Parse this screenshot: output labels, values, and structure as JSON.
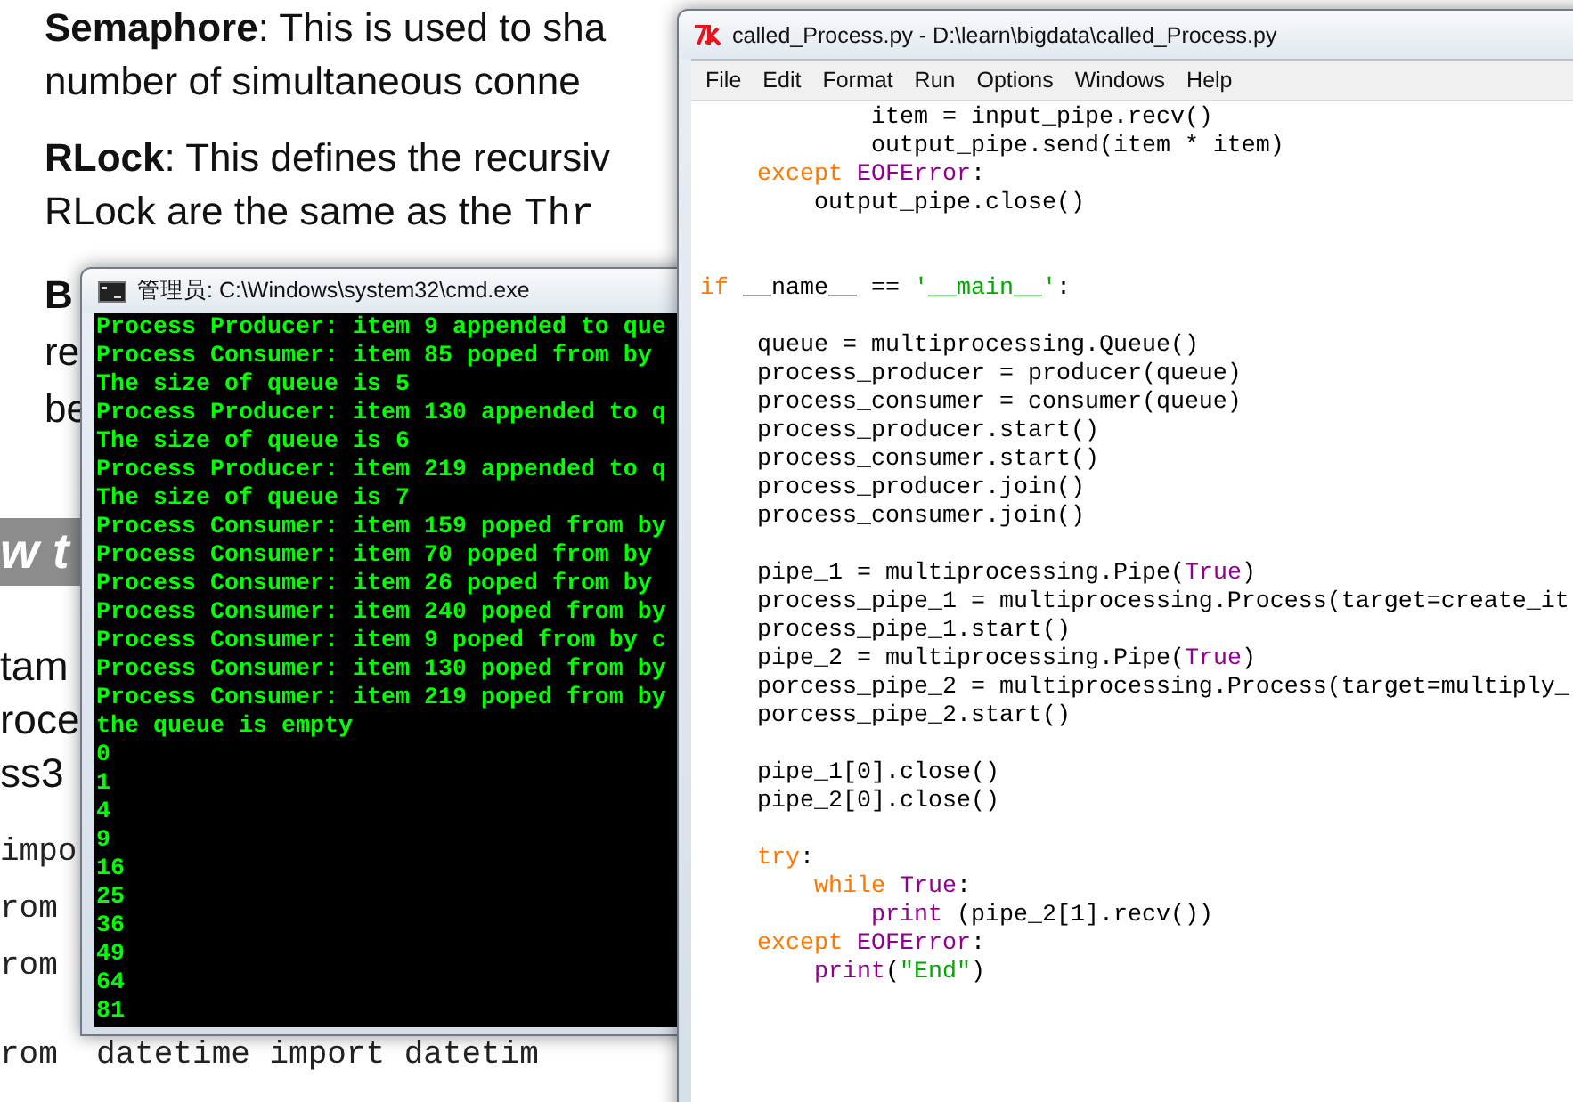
{
  "document": {
    "blocks": [
      {
        "kind": "paragraph",
        "lines": [
          [
            {
              "kind": "bold",
              "text": "Semaphore"
            },
            {
              "kind": "plain",
              "text": ": This is used to sha"
            }
          ],
          [
            {
              "kind": "plain",
              "text": "number of simultaneous conne"
            }
          ]
        ]
      },
      {
        "kind": "paragraph",
        "lines": [
          [
            {
              "kind": "bold",
              "text": "RLock"
            },
            {
              "kind": "plain",
              "text": ": This defines the recursiv"
            }
          ],
          [
            {
              "kind": "plain",
              "text": "RLock are the same as the "
            },
            {
              "kind": "mono",
              "text": "Thr"
            }
          ]
        ]
      },
      {
        "kind": "paragraph",
        "lines": [
          [
            {
              "kind": "bold",
              "text": "B"
            }
          ],
          [
            {
              "kind": "plain",
              "text": "re"
            }
          ],
          [
            {
              "kind": "plain",
              "text": "be"
            }
          ]
        ]
      },
      {
        "kind": "heading",
        "text": "w t"
      },
      {
        "kind": "cut_paragraph",
        "lines": [
          [
            {
              "kind": "plain",
              "text": "tam"
            }
          ],
          [
            {
              "kind": "plain",
              "text": "roce"
            }
          ],
          [
            {
              "kind": "plain",
              "text": "ss3"
            }
          ]
        ]
      },
      {
        "kind": "code",
        "lines": [
          "impo",
          "rom",
          "rom",
          "rom  datetime import datetim"
        ]
      }
    ]
  },
  "console": {
    "title": "管理员: C:\\Windows\\system32\\cmd.exe",
    "lines": [
      "Process Producer: item 9 appended to que",
      "Process Consumer: item 85 poped from by",
      "The size of queue is 5",
      "Process Producer: item 130 appended to q",
      "The size of queue is 6",
      "Process Producer: item 219 appended to q",
      "The size of queue is 7",
      "Process Consumer: item 159 poped from by",
      "Process Consumer: item 70 poped from by",
      "Process Consumer: item 26 poped from by",
      "Process Consumer: item 240 poped from by",
      "Process Consumer: item 9 poped from by c",
      "Process Consumer: item 130 poped from by",
      "Process Consumer: item 219 poped from by",
      "the queue is empty",
      "0",
      "1",
      "4",
      "9",
      "16",
      "25",
      "36",
      "49",
      "64",
      "81"
    ]
  },
  "editor": {
    "title": "called_Process.py - D:\\learn\\bigdata\\called_Process.py",
    "menu": [
      "File",
      "Edit",
      "Format",
      "Run",
      "Options",
      "Windows",
      "Help"
    ],
    "lines": [
      {
        "kind": "code",
        "tokens": [
          {
            "kind": "plain",
            "text": "            item = input_pipe.recv()"
          }
        ]
      },
      {
        "kind": "code",
        "tokens": [
          {
            "kind": "plain",
            "text": "            output_pipe.send(item * item)"
          }
        ]
      },
      {
        "kind": "code",
        "tokens": [
          {
            "kind": "keyword",
            "text": "    except "
          },
          {
            "kind": "builtin",
            "text": "EOFError"
          },
          {
            "kind": "plain",
            "text": ":"
          }
        ]
      },
      {
        "kind": "code",
        "tokens": [
          {
            "kind": "plain",
            "text": "        output_pipe.close()"
          }
        ]
      },
      {
        "kind": "blank"
      },
      {
        "kind": "blank"
      },
      {
        "kind": "code",
        "tokens": [
          {
            "kind": "keyword",
            "text": "if"
          },
          {
            "kind": "plain",
            "text": " __name__ == "
          },
          {
            "kind": "string",
            "text": "'__main__'"
          },
          {
            "kind": "plain",
            "text": ":"
          }
        ]
      },
      {
        "kind": "blank"
      },
      {
        "kind": "code",
        "tokens": [
          {
            "kind": "plain",
            "text": "    queue = multiprocessing.Queue()"
          }
        ]
      },
      {
        "kind": "code",
        "tokens": [
          {
            "kind": "plain",
            "text": "    process_producer = producer(queue)"
          }
        ]
      },
      {
        "kind": "code",
        "tokens": [
          {
            "kind": "plain",
            "text": "    process_consumer = consumer(queue)"
          }
        ]
      },
      {
        "kind": "code",
        "tokens": [
          {
            "kind": "plain",
            "text": "    process_producer.start()"
          }
        ]
      },
      {
        "kind": "code",
        "tokens": [
          {
            "kind": "plain",
            "text": "    process_consumer.start()"
          }
        ]
      },
      {
        "kind": "code",
        "tokens": [
          {
            "kind": "plain",
            "text": "    process_producer.join()"
          }
        ]
      },
      {
        "kind": "code",
        "tokens": [
          {
            "kind": "plain",
            "text": "    process_consumer.join()"
          }
        ]
      },
      {
        "kind": "blank"
      },
      {
        "kind": "code",
        "tokens": [
          {
            "kind": "plain",
            "text": "    pipe_1 = multiprocessing.Pipe("
          },
          {
            "kind": "builtin",
            "text": "True"
          },
          {
            "kind": "plain",
            "text": ")"
          }
        ]
      },
      {
        "kind": "code",
        "tokens": [
          {
            "kind": "plain",
            "text": "    process_pipe_1 = multiprocessing.Process(target=create_it"
          }
        ]
      },
      {
        "kind": "code",
        "tokens": [
          {
            "kind": "plain",
            "text": "    process_pipe_1.start()"
          }
        ]
      },
      {
        "kind": "code",
        "tokens": [
          {
            "kind": "plain",
            "text": "    pipe_2 = multiprocessing.Pipe("
          },
          {
            "kind": "builtin",
            "text": "True"
          },
          {
            "kind": "plain",
            "text": ")"
          }
        ]
      },
      {
        "kind": "code",
        "tokens": [
          {
            "kind": "plain",
            "text": "    porcess_pipe_2 = multiprocessing.Process(target=multiply_"
          }
        ]
      },
      {
        "kind": "code",
        "tokens": [
          {
            "kind": "plain",
            "text": "    porcess_pipe_2.start()"
          }
        ]
      },
      {
        "kind": "blank"
      },
      {
        "kind": "code",
        "tokens": [
          {
            "kind": "plain",
            "text": "    pipe_1[0].close()"
          }
        ]
      },
      {
        "kind": "code",
        "tokens": [
          {
            "kind": "plain",
            "text": "    pipe_2[0].close()"
          }
        ]
      },
      {
        "kind": "blank"
      },
      {
        "kind": "code",
        "tokens": [
          {
            "kind": "keyword",
            "text": "    try"
          },
          {
            "kind": "plain",
            "text": ":"
          }
        ]
      },
      {
        "kind": "code",
        "tokens": [
          {
            "kind": "keyword",
            "text": "        while "
          },
          {
            "kind": "builtin",
            "text": "True"
          },
          {
            "kind": "plain",
            "text": ":"
          }
        ]
      },
      {
        "kind": "code",
        "tokens": [
          {
            "kind": "builtin",
            "text": "            print"
          },
          {
            "kind": "plain",
            "text": " (pipe_2[1].recv())"
          }
        ]
      },
      {
        "kind": "code",
        "tokens": [
          {
            "kind": "keyword",
            "text": "    except "
          },
          {
            "kind": "builtin",
            "text": "EOFError"
          },
          {
            "kind": "plain",
            "text": ":"
          }
        ]
      },
      {
        "kind": "code",
        "tokens": [
          {
            "kind": "builtin",
            "text": "        print"
          },
          {
            "kind": "plain",
            "text": "("
          },
          {
            "kind": "string",
            "text": "\"End\""
          },
          {
            "kind": "plain",
            "text": ")"
          }
        ]
      }
    ]
  }
}
